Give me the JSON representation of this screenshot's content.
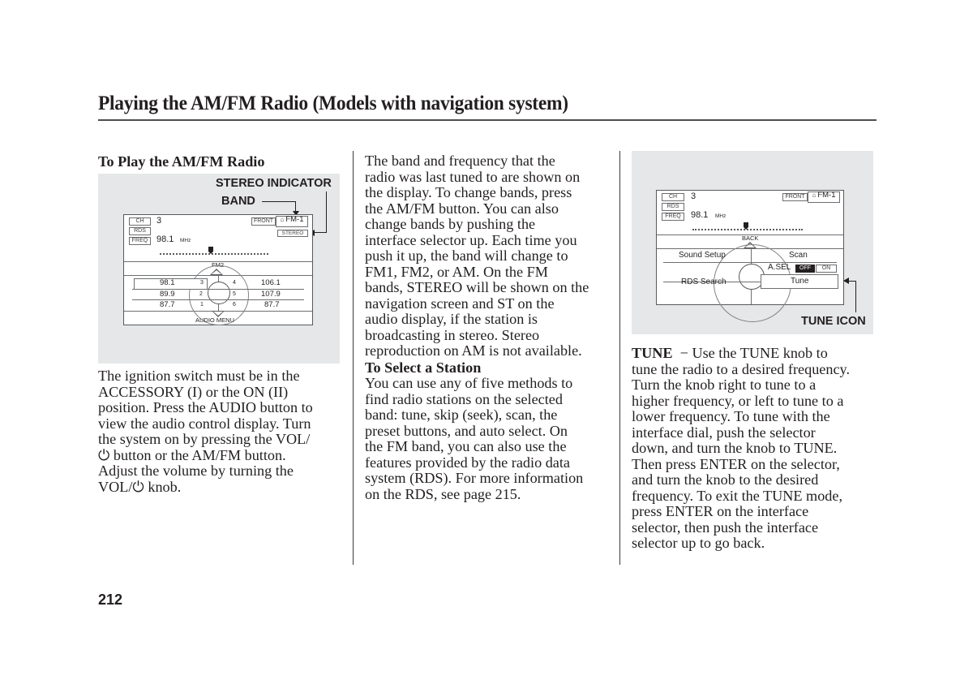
{
  "page": {
    "title": "Playing the AM/FM Radio (Models with navigation system)",
    "page_number": "212"
  },
  "col1": {
    "heading": "To Play the AM/FM Radio",
    "figure": {
      "callouts": {
        "stereo_indicator": "STEREO INDICATOR",
        "band": "BAND"
      },
      "screen": {
        "ch_label": "CH",
        "ch_value": "3",
        "rds_label": "RDS",
        "freq_label": "FREQ",
        "freq_value": "98.1",
        "freq_unit": "MHz",
        "front_label": "FRONT",
        "band_value": "FM-1",
        "stereo_label": "STEREO",
        "up_label": "FM2",
        "down_label": "AUDIO MENU",
        "presets_left": [
          {
            "freq": "98.1",
            "num": "3"
          },
          {
            "freq": "89.9",
            "num": "2"
          },
          {
            "freq": "87.7",
            "num": "1"
          }
        ],
        "presets_right": [
          {
            "freq": "106.1",
            "num": "4"
          },
          {
            "freq": "107.9",
            "num": "5"
          },
          {
            "freq": "87.7",
            "num": "6"
          }
        ]
      }
    },
    "paragraph_lines": [
      "The ignition switch must be in the",
      "ACCESSORY (I) or the ON (II)",
      "position. Press the AUDIO button to",
      "view the audio control display. Turn",
      "the system on by pressing the VOL/",
      "⏻ button or the AM/FM button.",
      "Adjust the volume by turning the",
      "VOL/⏻ knob."
    ]
  },
  "col2": {
    "paragraph1_lines": [
      "The band and frequency that the",
      "radio was last tuned to are shown on",
      "the display. To change bands, press",
      "the AM/FM button. You can also",
      "change bands by pushing the",
      "interface selector up. Each time you",
      "push it up, the band will change to",
      "FM1, FM2, or AM. On the FM",
      "bands, STEREO will be shown on the",
      "navigation screen and ST on the",
      "audio display, if the station is",
      "broadcasting in stereo. Stereo",
      "reproduction on AM is not available."
    ],
    "heading": "To Select a Station",
    "paragraph2_lines": [
      "You can use any of five methods to",
      "find radio stations on the selected",
      "band: tune, skip (seek), scan, the",
      "preset buttons, and auto select. On",
      "the FM band, you can also use the",
      "features provided by the radio data",
      "system (RDS). For more information",
      "on the RDS, see page 215."
    ]
  },
  "col3": {
    "figure": {
      "callout": "TUNE ICON",
      "screen": {
        "ch_label": "CH",
        "ch_value": "3",
        "rds_label": "RDS",
        "freq_label": "FREQ",
        "freq_value": "98.1",
        "freq_unit": "MHz",
        "front_label": "FRONT",
        "band_value": "FM-1",
        "up_label": "BACK",
        "menu": {
          "sound_setup": "Sound Setup",
          "scan": "Scan",
          "asel": "A.SEL",
          "asel_off": "OFF",
          "asel_on": "ON",
          "rds_search": "RDS Search",
          "tune": "Tune"
        }
      }
    },
    "term": "TUNE",
    "dash": "−",
    "paragraph_lines": [
      " Use the TUNE knob to",
      "tune the radio to a desired frequency.",
      "Turn the knob right to tune to a",
      "higher frequency, or left to tune to a",
      "lower frequency. To tune with the",
      "interface dial, push the selector",
      "down, and turn the knob to TUNE.",
      "Then press ENTER on the selector,",
      "and turn the knob to the desired",
      "frequency. To exit the TUNE mode,",
      "press ENTER on the interface",
      "selector, then push the interface",
      "selector up to go back."
    ]
  }
}
